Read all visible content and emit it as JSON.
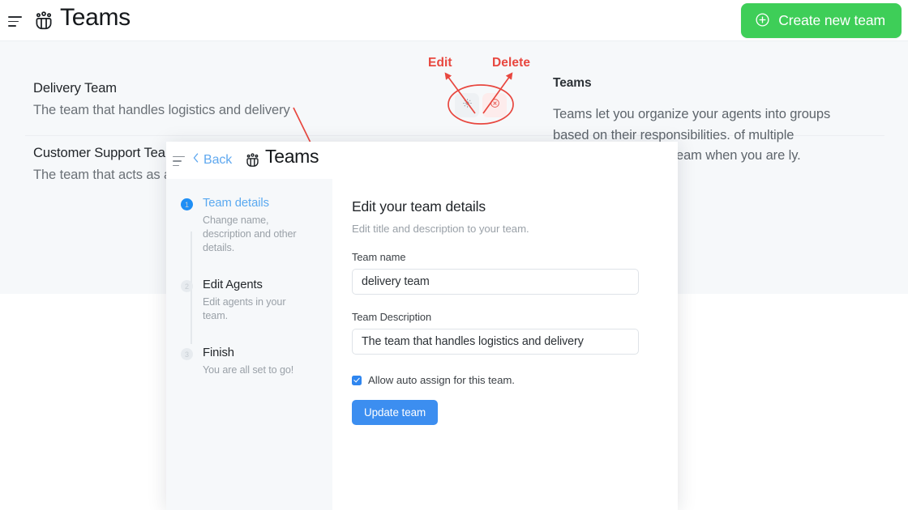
{
  "topbar": {
    "menu_icon": "hamburger-menu-icon",
    "brand_icon": "teams-group-icon",
    "title": "Teams",
    "create_button": {
      "icon": "plus-circle-icon",
      "label": "Create new team"
    }
  },
  "teams": [
    {
      "name": "Delivery Team",
      "description": "The team that handles logistics and delivery"
    },
    {
      "name": "Customer Support Tea",
      "description": "The team that acts as a"
    }
  ],
  "row_actions": {
    "edit_icon": "gear-icon",
    "delete_icon": "circle-x-icon"
  },
  "info_panel": {
    "title": "Teams",
    "body": "Teams let you organize your agents into groups based on their responsibilities. of multiple teams. You can to a team when you are ly."
  },
  "annotations": {
    "edit_label": "Edit",
    "delete_label": "Delete",
    "color": "#e8473f"
  },
  "overlay": {
    "header": {
      "menu_icon": "hamburger-menu-icon",
      "back_icon": "chevron-left-icon",
      "back_label": "Back",
      "brand_icon": "teams-group-icon",
      "title": "Teams"
    },
    "steps": [
      {
        "number": "1",
        "title": "Team details",
        "subtitle": "Change name, description and other details."
      },
      {
        "number": "2",
        "title": "Edit Agents",
        "subtitle": "Edit agents in your team."
      },
      {
        "number": "3",
        "title": "Finish",
        "subtitle": "You are all set to go!"
      }
    ],
    "form": {
      "title": "Edit your team details",
      "subtitle": "Edit title and description to your team.",
      "name_label": "Team name",
      "name_value": "delivery team",
      "name_placeholder": "Team name",
      "description_label": "Team Description",
      "description_value": "The team that handles logistics and delivery",
      "description_placeholder": "Team Description",
      "checkbox_label": "Allow auto assign for this team.",
      "submit_label": "Update team"
    }
  },
  "colors": {
    "accent_green": "#3ece58",
    "accent_blue": "#3c8ef0",
    "annotation_red": "#e8473f",
    "page_bg": "#f6f8fa"
  }
}
